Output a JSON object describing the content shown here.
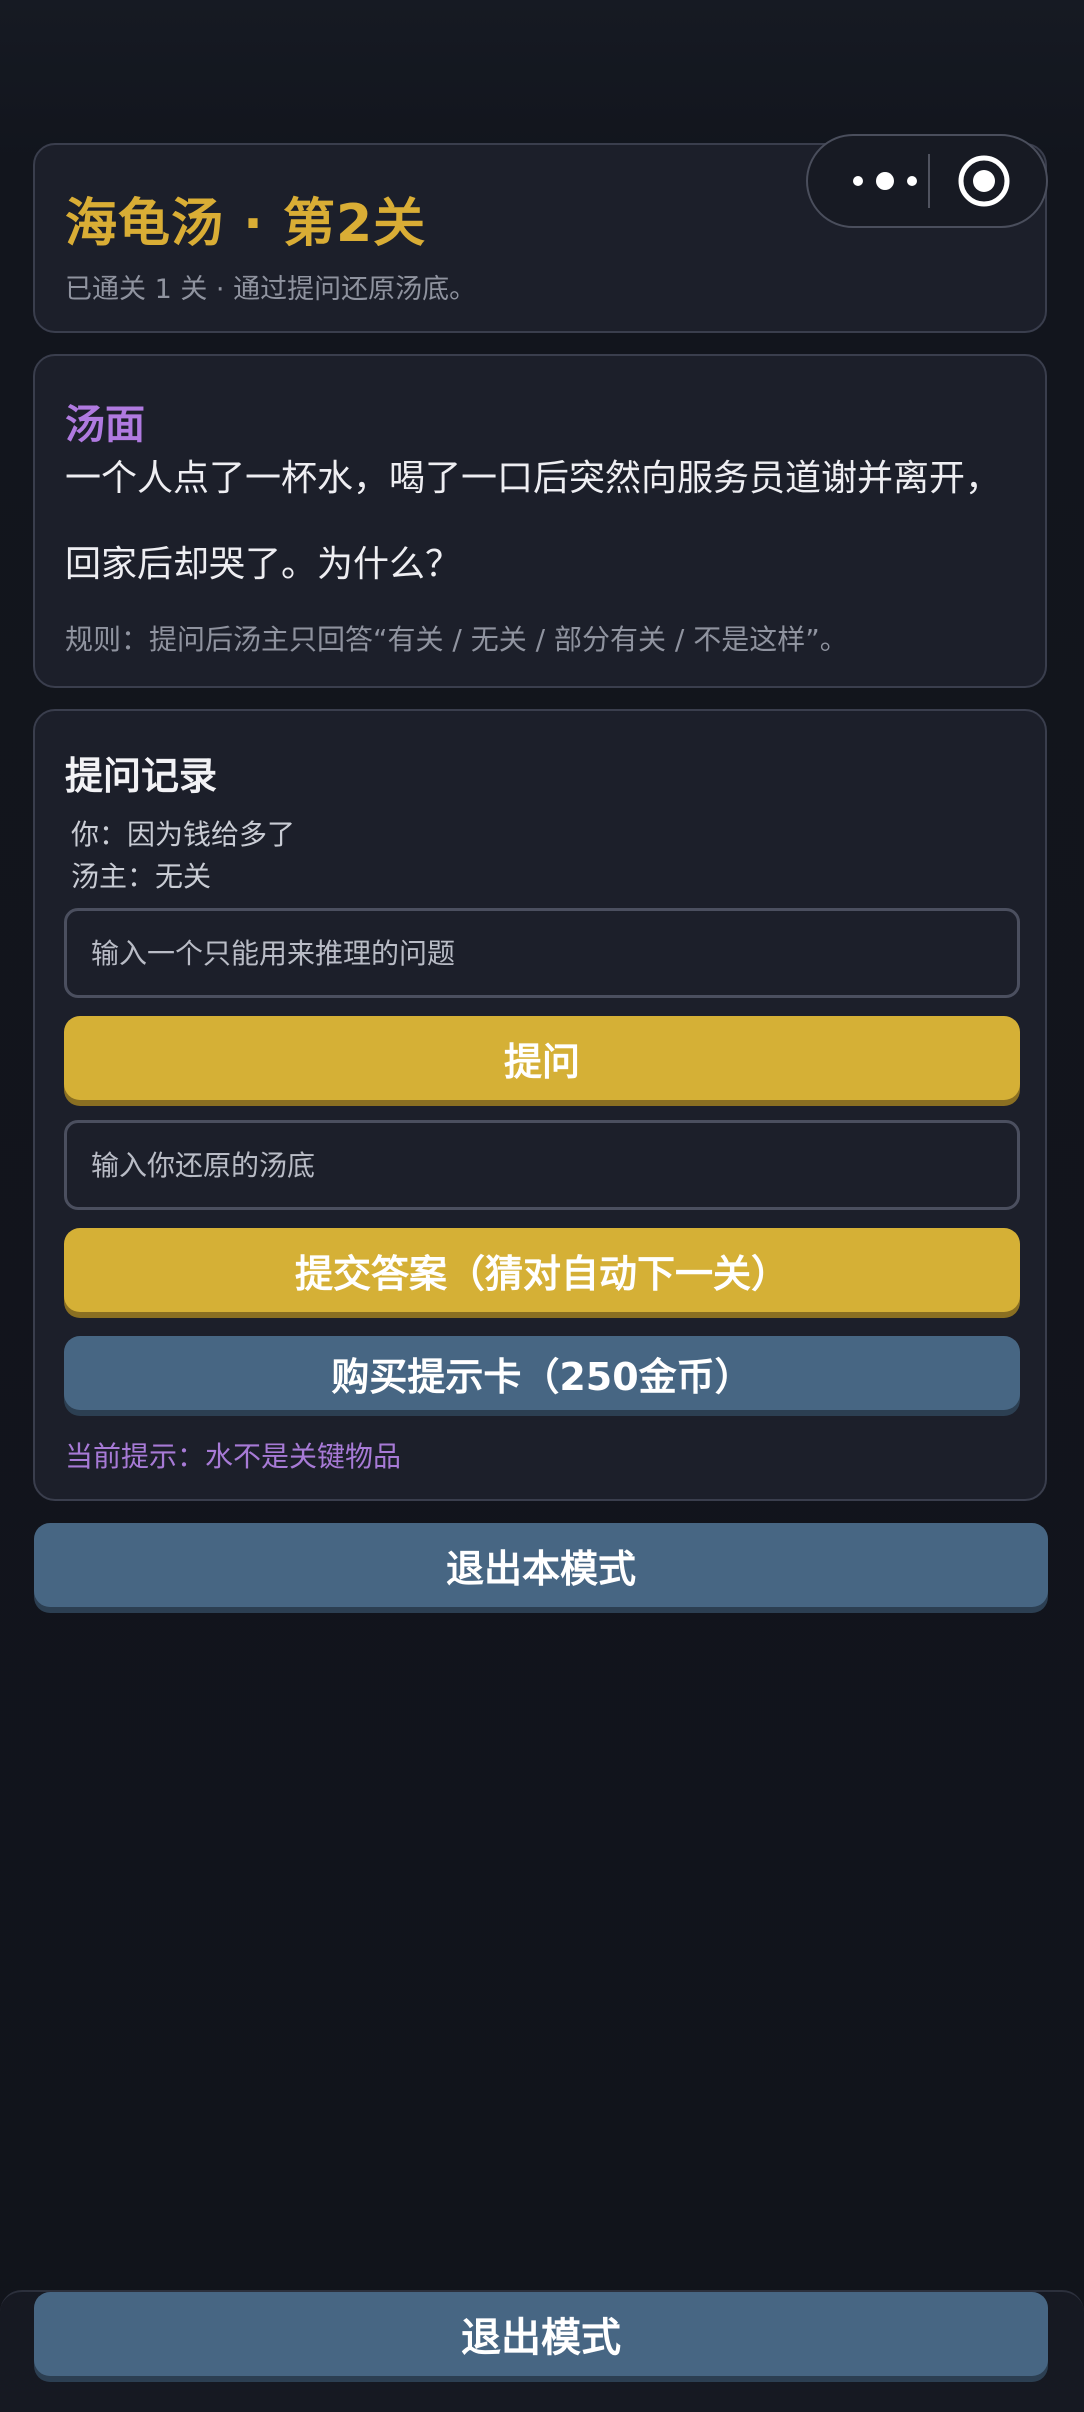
{
  "header": {
    "title": "海龟汤 · 第2关",
    "subtitle": "已通关 1 关 · 通过提问还原汤底。"
  },
  "capsule": {
    "more_icon": "more-dots-icon",
    "close_icon": "target-circle-icon"
  },
  "story": {
    "section_title": "汤面",
    "text": "一个人点了一杯水，喝了一口后突然向服务员道谢并离开，回家后却哭了。为什么？",
    "rule": "规则：提问后汤主只回答“有关 / 无关 / 部分有关 / 不是这样”。"
  },
  "qa": {
    "section_title": "提问记录",
    "log": [
      {
        "text": "你：因为钱给多了"
      },
      {
        "text": "汤主：无关"
      }
    ],
    "question_input": {
      "value": "",
      "placeholder": "输入一个只能用来推理的问题"
    },
    "ask_label": "提问",
    "answer_input": {
      "value": "",
      "placeholder": "输入你还原的汤底"
    },
    "submit_label": "提交答案（猜对自动下一关）",
    "buy_hint_label": "购买提示卡（250金币）",
    "current_hint": "当前提示：水不是关键物品"
  },
  "exit_mode_label": "退出本模式",
  "bottom_bar": {
    "exit_label": "退出模式"
  },
  "colors": {
    "accent_gold": "#d5b036",
    "accent_purple": "#b07ae0",
    "button_steel": "#476683",
    "background": "#11141b"
  }
}
